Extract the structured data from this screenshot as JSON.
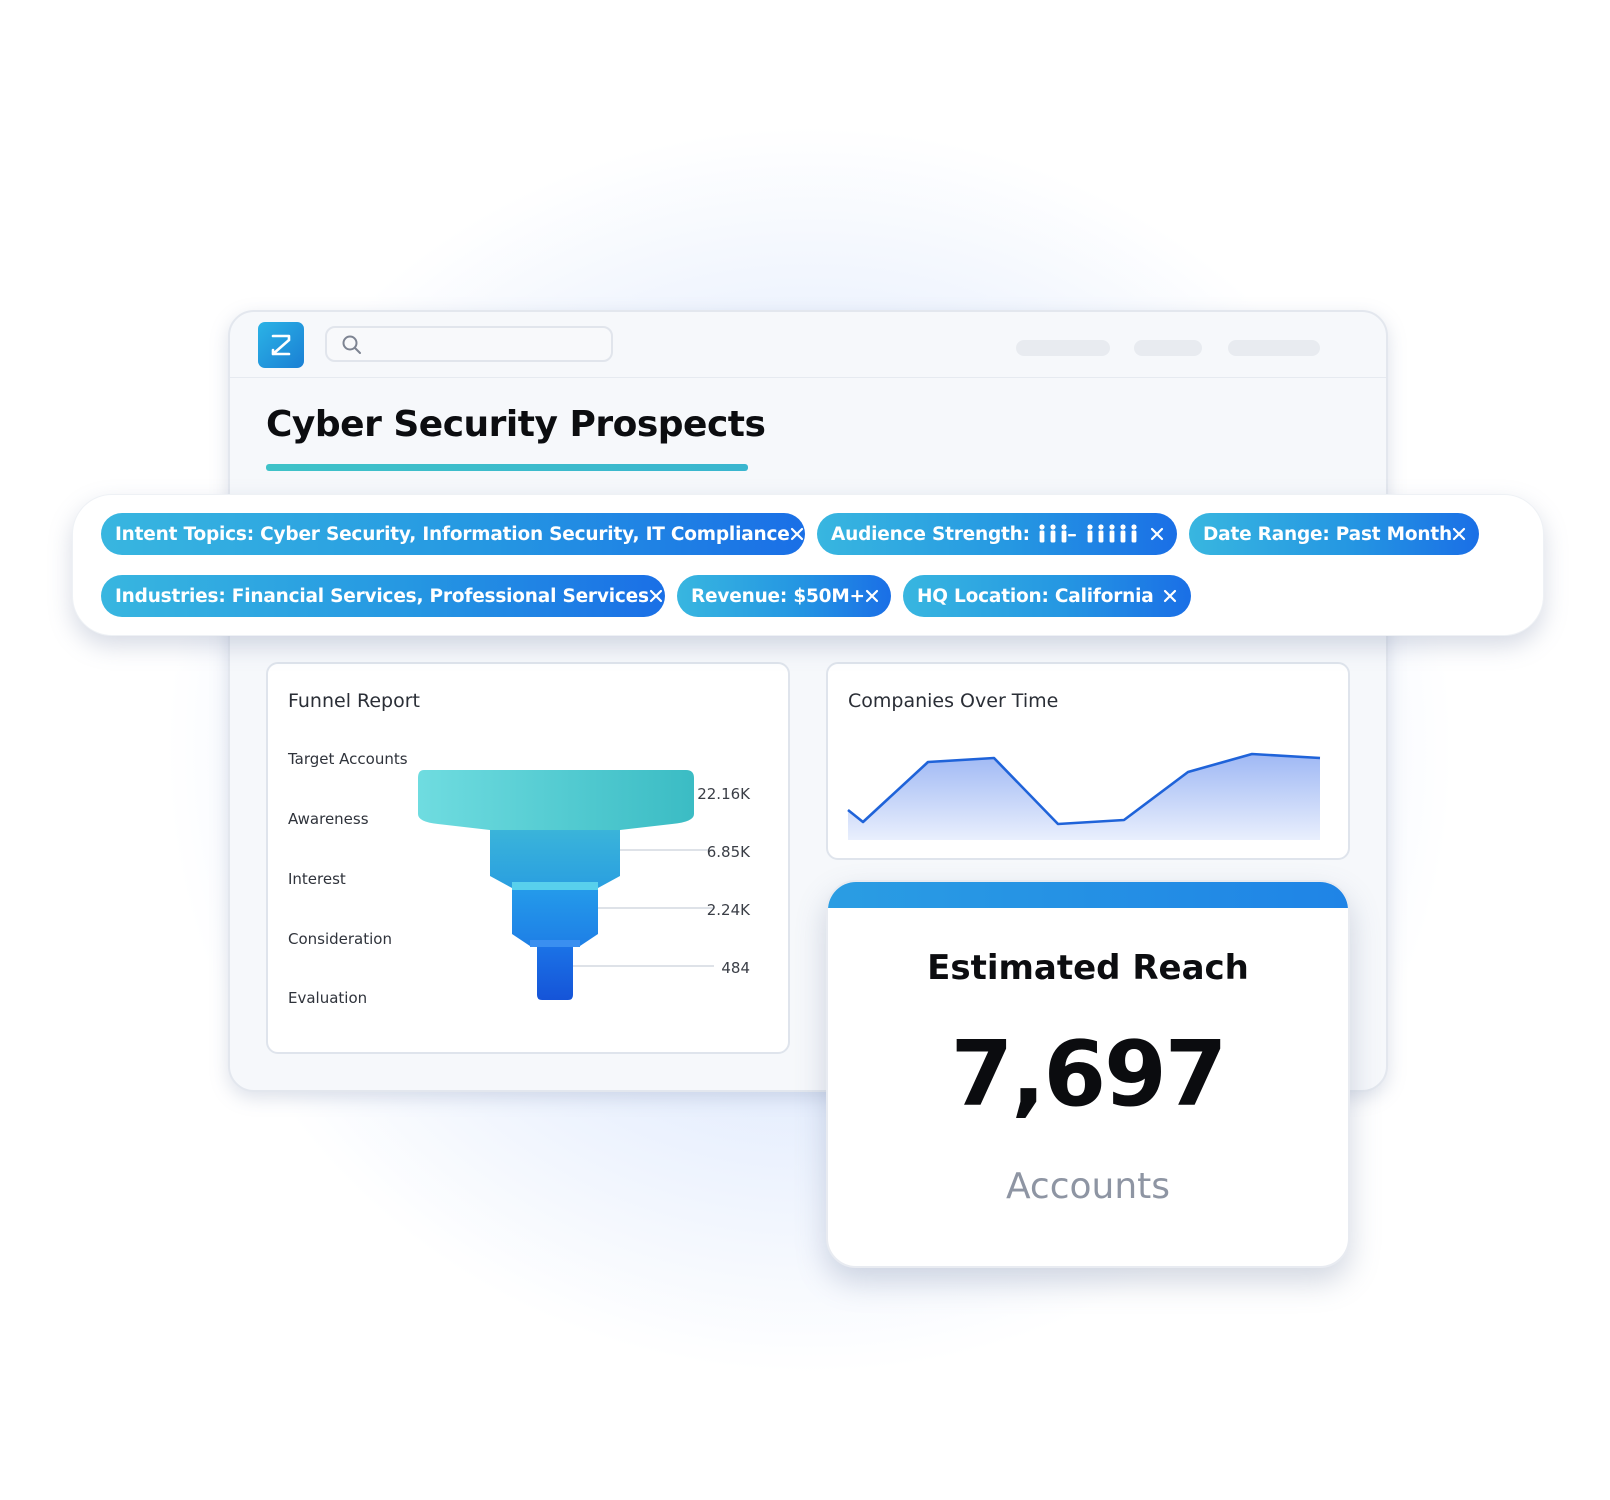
{
  "search": {
    "placeholder": ""
  },
  "page": {
    "title": "Cyber Security Prospects"
  },
  "filters": [
    {
      "label": "Intent Topics: Cyber Security, Information Security, IT Compliance",
      "icon": "close-icon"
    },
    {
      "label": "Audience Strength:",
      "icon": "close-icon",
      "people_icons": "people-strength-icons"
    },
    {
      "label": "Date Range: Past Month",
      "icon": "close-icon"
    },
    {
      "label": "Industries: Financial Services, Professional Services",
      "icon": "close-icon"
    },
    {
      "label": "Revenue: $50M+",
      "icon": "close-icon"
    },
    {
      "label": "HQ Location: California",
      "icon": "close-icon"
    }
  ],
  "funnel": {
    "title": "Funnel Report",
    "stages": [
      "Target Accounts",
      "Awareness",
      "Interest",
      "Consideration",
      "Evaluation"
    ],
    "values": [
      "22.16K",
      "6.85K",
      "2.24K",
      "484"
    ],
    "colors": [
      "#5dd3d7",
      "#3fb8d8",
      "#2596e6",
      "#1560e0"
    ]
  },
  "timeline": {
    "title": "Companies Over Time",
    "line_color": "#1f63d9",
    "fill_color": "#aac1f5"
  },
  "reach": {
    "title": "Estimated Reach",
    "value": "7,697",
    "unit": "Accounts"
  },
  "colors": {
    "accent": "#2597e2",
    "title_underline": "#3fc2c8"
  }
}
